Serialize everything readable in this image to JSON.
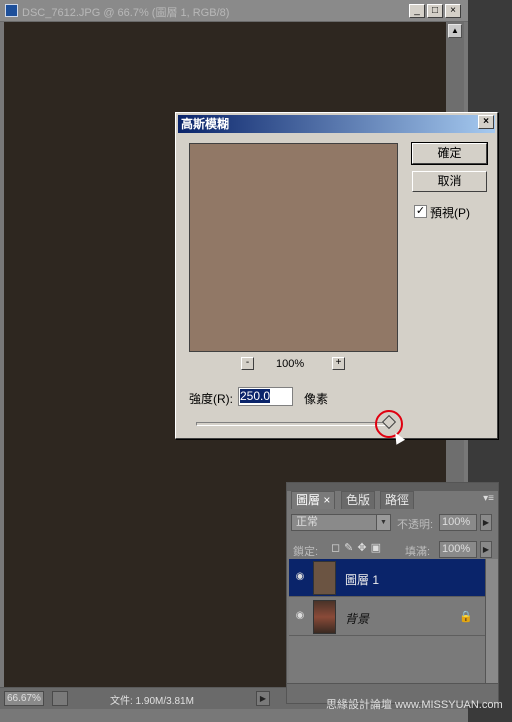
{
  "document": {
    "title": "DSC_7612.JPG @ 66.7% (圖層 1, RGB/8)",
    "zoom": "66.67%",
    "file_info": "文件: 1.90M/3.81M",
    "min_btn": "_",
    "max_btn": "□",
    "close_btn": "×",
    "scroll_up": "▲",
    "status_arrow": "▶"
  },
  "dialog": {
    "title": "高斯模糊",
    "close": "×",
    "ok_label": "確定",
    "cancel_label": "取消",
    "preview_checked": "✓",
    "preview_label": "預視(P)",
    "zoom_minus": "-",
    "zoom_level": "100%",
    "zoom_plus": "+",
    "radius_label": "強度(R):",
    "radius_value": "250.0",
    "unit": "像素",
    "preview_color": "#917866",
    "slider_value": 250.0
  },
  "layers_panel": {
    "tabs": [
      "圖層 ×",
      "色版",
      "路徑"
    ],
    "menu": "▾≡",
    "blend_mode": "正常",
    "opacity_label": "不透明:",
    "opacity_value": "100%",
    "lock_label": "鎖定:",
    "fill_label": "填滿:",
    "fill_value": "100%",
    "arrow": "▶",
    "layers": [
      {
        "name": "圖層 1",
        "selected": true
      },
      {
        "name": "背景",
        "selected": false,
        "locked": true
      }
    ]
  },
  "watermark": "思緣設計論壇 www.MISSYUAN.com"
}
